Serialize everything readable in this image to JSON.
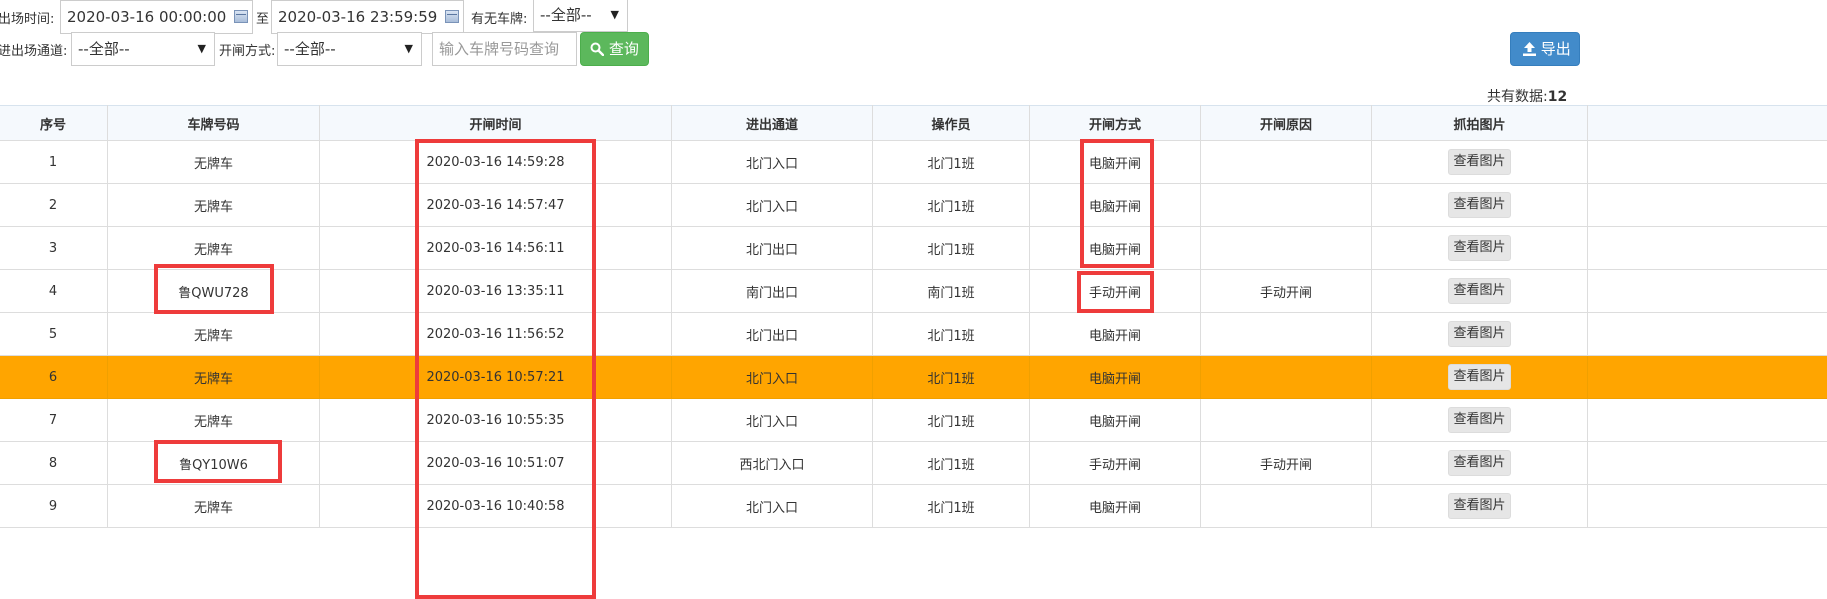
{
  "filters": {
    "exit_time_label": "出场时间:",
    "start_time": "2020-03-16 00:00:00",
    "to_label": "至",
    "end_time": "2020-03-16 23:59:59",
    "plate_status_label": "有无车牌:",
    "plate_status_value": "--全部--",
    "channel_label": "进出场通道:",
    "channel_value": "--全部--",
    "open_mode_label": "开闸方式:",
    "open_mode_value": "--全部--",
    "plate_search_placeholder": "输入车牌号码查询",
    "query_button": "查询",
    "export_button": "导出"
  },
  "summary": {
    "label": "共有数据:",
    "count": "12"
  },
  "table": {
    "headers": [
      "序号",
      "车牌号码",
      "开闸时间",
      "进出通道",
      "操作员",
      "开闸方式",
      "开闸原因",
      "抓拍图片"
    ],
    "view_label": "查看图片",
    "rows": [
      {
        "no": "1",
        "plate": "无牌车",
        "time": "2020-03-16 14:59:28",
        "channel": "北门入口",
        "operator": "北门1班",
        "mode": "电脑开闸",
        "reason": ""
      },
      {
        "no": "2",
        "plate": "无牌车",
        "time": "2020-03-16 14:57:47",
        "channel": "北门入口",
        "operator": "北门1班",
        "mode": "电脑开闸",
        "reason": ""
      },
      {
        "no": "3",
        "plate": "无牌车",
        "time": "2020-03-16 14:56:11",
        "channel": "北门出口",
        "operator": "北门1班",
        "mode": "电脑开闸",
        "reason": ""
      },
      {
        "no": "4",
        "plate": "鲁QWU728",
        "time": "2020-03-16 13:35:11",
        "channel": "南门出口",
        "operator": "南门1班",
        "mode": "手动开闸",
        "reason": "手动开闸"
      },
      {
        "no": "5",
        "plate": "无牌车",
        "time": "2020-03-16 11:56:52",
        "channel": "北门出口",
        "operator": "北门1班",
        "mode": "电脑开闸",
        "reason": ""
      },
      {
        "no": "6",
        "plate": "无牌车",
        "time": "2020-03-16 10:57:21",
        "channel": "北门入口",
        "operator": "北门1班",
        "mode": "电脑开闸",
        "reason": "",
        "highlight": true
      },
      {
        "no": "7",
        "plate": "无牌车",
        "time": "2020-03-16 10:55:35",
        "channel": "北门入口",
        "operator": "北门1班",
        "mode": "电脑开闸",
        "reason": ""
      },
      {
        "no": "8",
        "plate": "鲁QY10W6",
        "time": "2020-03-16 10:51:07",
        "channel": "西北门入口",
        "operator": "北门1班",
        "mode": "手动开闸",
        "reason": "手动开闸"
      },
      {
        "no": "9",
        "plate": "无牌车",
        "time": "2020-03-16 10:40:58",
        "channel": "北门入口",
        "operator": "北门1班",
        "mode": "电脑开闸",
        "reason": ""
      }
    ]
  },
  "colors": {
    "highlight_row": "#ffa500",
    "annotation": "#ee3b3b",
    "query": "#5cb85c",
    "export": "#428bca"
  }
}
